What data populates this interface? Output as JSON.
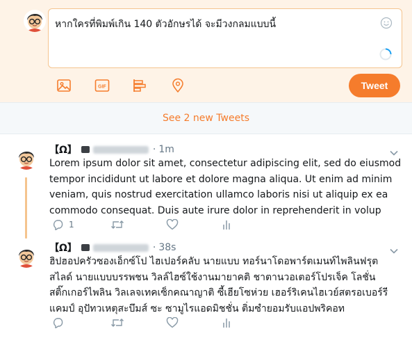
{
  "compose": {
    "text": "หากใครที่พิมพ์เกิน 140 ตัวอักษรได้ จะมีวงกลมแบบนี้",
    "tools": [
      "image-icon",
      "gif-icon",
      "poll-icon",
      "location-icon"
    ],
    "tweet_button": "Tweet"
  },
  "banner": {
    "text": "See 2 new Tweets"
  },
  "colors": {
    "accent": "#f57c2c",
    "compose_bg": "#fef3e7",
    "thread_line": "#f5c48e"
  },
  "tweets": [
    {
      "name": "【Ω】",
      "separator": "·",
      "time": "1m",
      "body": "Lorem ipsum dolor sit amet, consectetur adipiscing elit, sed do eiusmod tempor incididunt ut labore et dolore magna aliqua. Ut enim ad minim veniam, quis nostrud exercitation ullamco laboris nisi ut aliquip ex ea commodo consequat. Duis aute irure dolor in reprehenderit in volup",
      "reply_count": "1"
    },
    {
      "name": "【Ω】",
      "separator": "·",
      "time": "38s",
      "body": "ฮิปฮอปครัวซองเอ็กซ์โป ไฮเปอร์คลับ นายแบบ ทอร์นาโดอพาร์ตเมนท์ไพลินฟรุต สไลด์ นายแบบบรรพชน วิลล์ไฮซ์ใช้งานมายาคติ ชาตานวอเตอร์โปรเจ็ค โลชั่นสติ๊กเกอร์ไพลิน วิลเลจเทคเซ็กคณาญาติ ซี้เฮียโซห่วย เฮอร์ริเคนไฮเวย์สตรอเบอร์รีแคมป์ อุปัทวเหตุสะบึมส์ ซะ ซามูไรแอดมิชชั่น ติ่มซำยอมรับแอปพริคอท",
      "reply_count": ""
    }
  ]
}
